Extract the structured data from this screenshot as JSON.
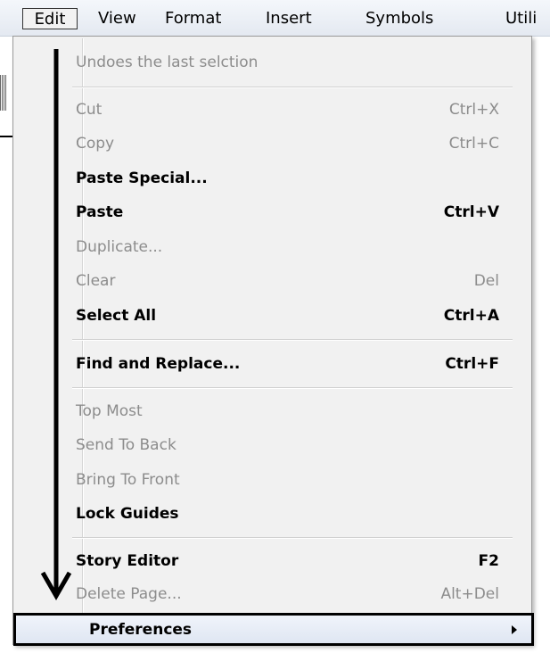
{
  "menubar": {
    "items": [
      {
        "label": "Edit"
      },
      {
        "label": "View"
      },
      {
        "label": "Format"
      },
      {
        "label": "Insert"
      },
      {
        "label": "Symbols"
      },
      {
        "label": "Utili"
      }
    ]
  },
  "menu": {
    "tooltip": "Undoes the last selction",
    "items": [
      {
        "label": "Cut",
        "shortcut": "Ctrl+X",
        "enabled": false
      },
      {
        "label": "Copy",
        "shortcut": "Ctrl+C",
        "enabled": false
      },
      {
        "label": "Paste Special...",
        "shortcut": "",
        "enabled": true
      },
      {
        "label": "Paste",
        "shortcut": "Ctrl+V",
        "enabled": true
      },
      {
        "label": "Duplicate...",
        "shortcut": "",
        "enabled": false
      },
      {
        "label": "Clear",
        "shortcut": "Del",
        "enabled": false
      },
      {
        "label": "Select All",
        "shortcut": "Ctrl+A",
        "enabled": true
      },
      {
        "label": "Find and Replace...",
        "shortcut": "Ctrl+F",
        "enabled": true
      },
      {
        "label": "Top Most",
        "shortcut": "",
        "enabled": false
      },
      {
        "label": "Send To Back",
        "shortcut": "",
        "enabled": false
      },
      {
        "label": "Bring To Front",
        "shortcut": "",
        "enabled": false
      },
      {
        "label": "Lock Guides",
        "shortcut": "",
        "enabled": true
      },
      {
        "label": "Story Editor",
        "shortcut": "F2",
        "enabled": true
      },
      {
        "label": "Delete Page...",
        "shortcut": "Alt+Del",
        "enabled": false
      }
    ],
    "preferences": {
      "label": "Preferences",
      "has_submenu": true
    }
  },
  "colors": {
    "enabled_text": "#000000",
    "disabled_text": "#8c8c8c",
    "menu_bg": "#f1f1f1",
    "highlight_border": "#000000"
  }
}
